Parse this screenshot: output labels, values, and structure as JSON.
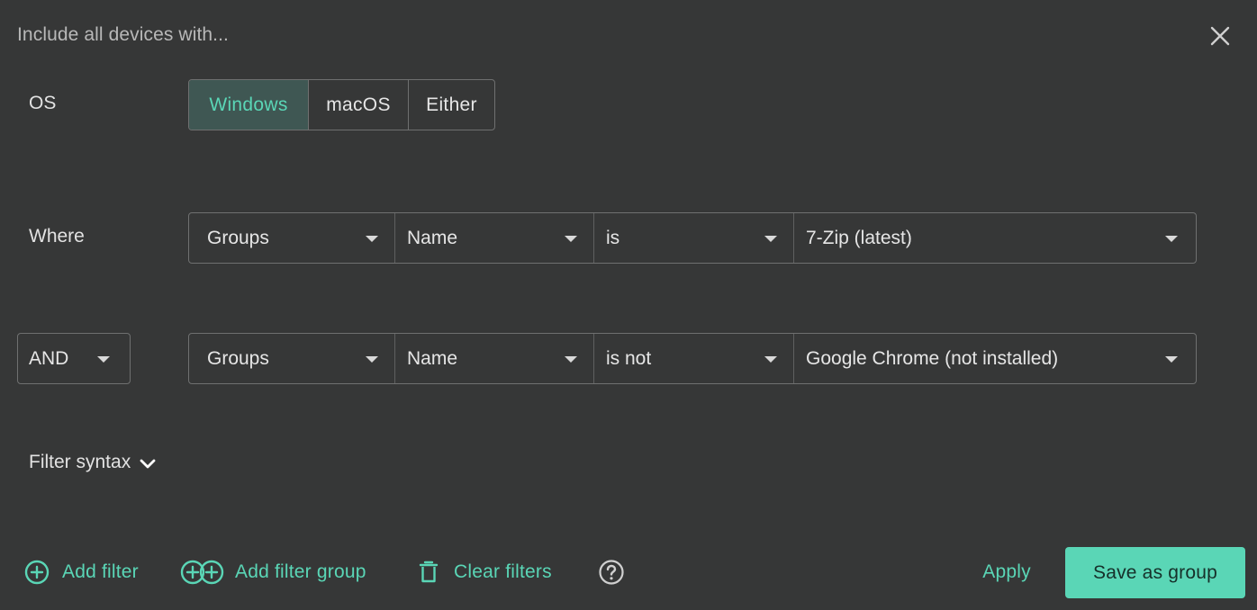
{
  "header": {
    "title": "Include all devices with..."
  },
  "os": {
    "label": "OS",
    "options": [
      "Windows",
      "macOS",
      "Either"
    ],
    "selected": "Windows"
  },
  "filters": [
    {
      "label": "Where",
      "field": "Groups",
      "attribute": "Name",
      "operator": "is",
      "value": "7-Zip (latest)"
    },
    {
      "connector": "AND",
      "field": "Groups",
      "attribute": "Name",
      "operator": "is not",
      "value": "Google Chrome (not installed)"
    }
  ],
  "filter_syntax": {
    "label": "Filter syntax"
  },
  "actions": {
    "add_filter": "Add filter",
    "add_filter_group": "Add filter group",
    "clear_filters": "Clear filters",
    "apply": "Apply",
    "save_as_group": "Save as group"
  },
  "colors": {
    "background": "#363737",
    "accent": "#5ad6b6",
    "selected_segment_bg": "#3f5753",
    "border": "#6f7070"
  },
  "icons": {
    "close": "close-icon",
    "caret": "caret-down-icon",
    "chevron": "chevron-down-icon",
    "add": "plus-circle-icon",
    "add_group": "double-plus-circle-icon",
    "clear": "trash-icon",
    "help": "help-circle-icon"
  }
}
